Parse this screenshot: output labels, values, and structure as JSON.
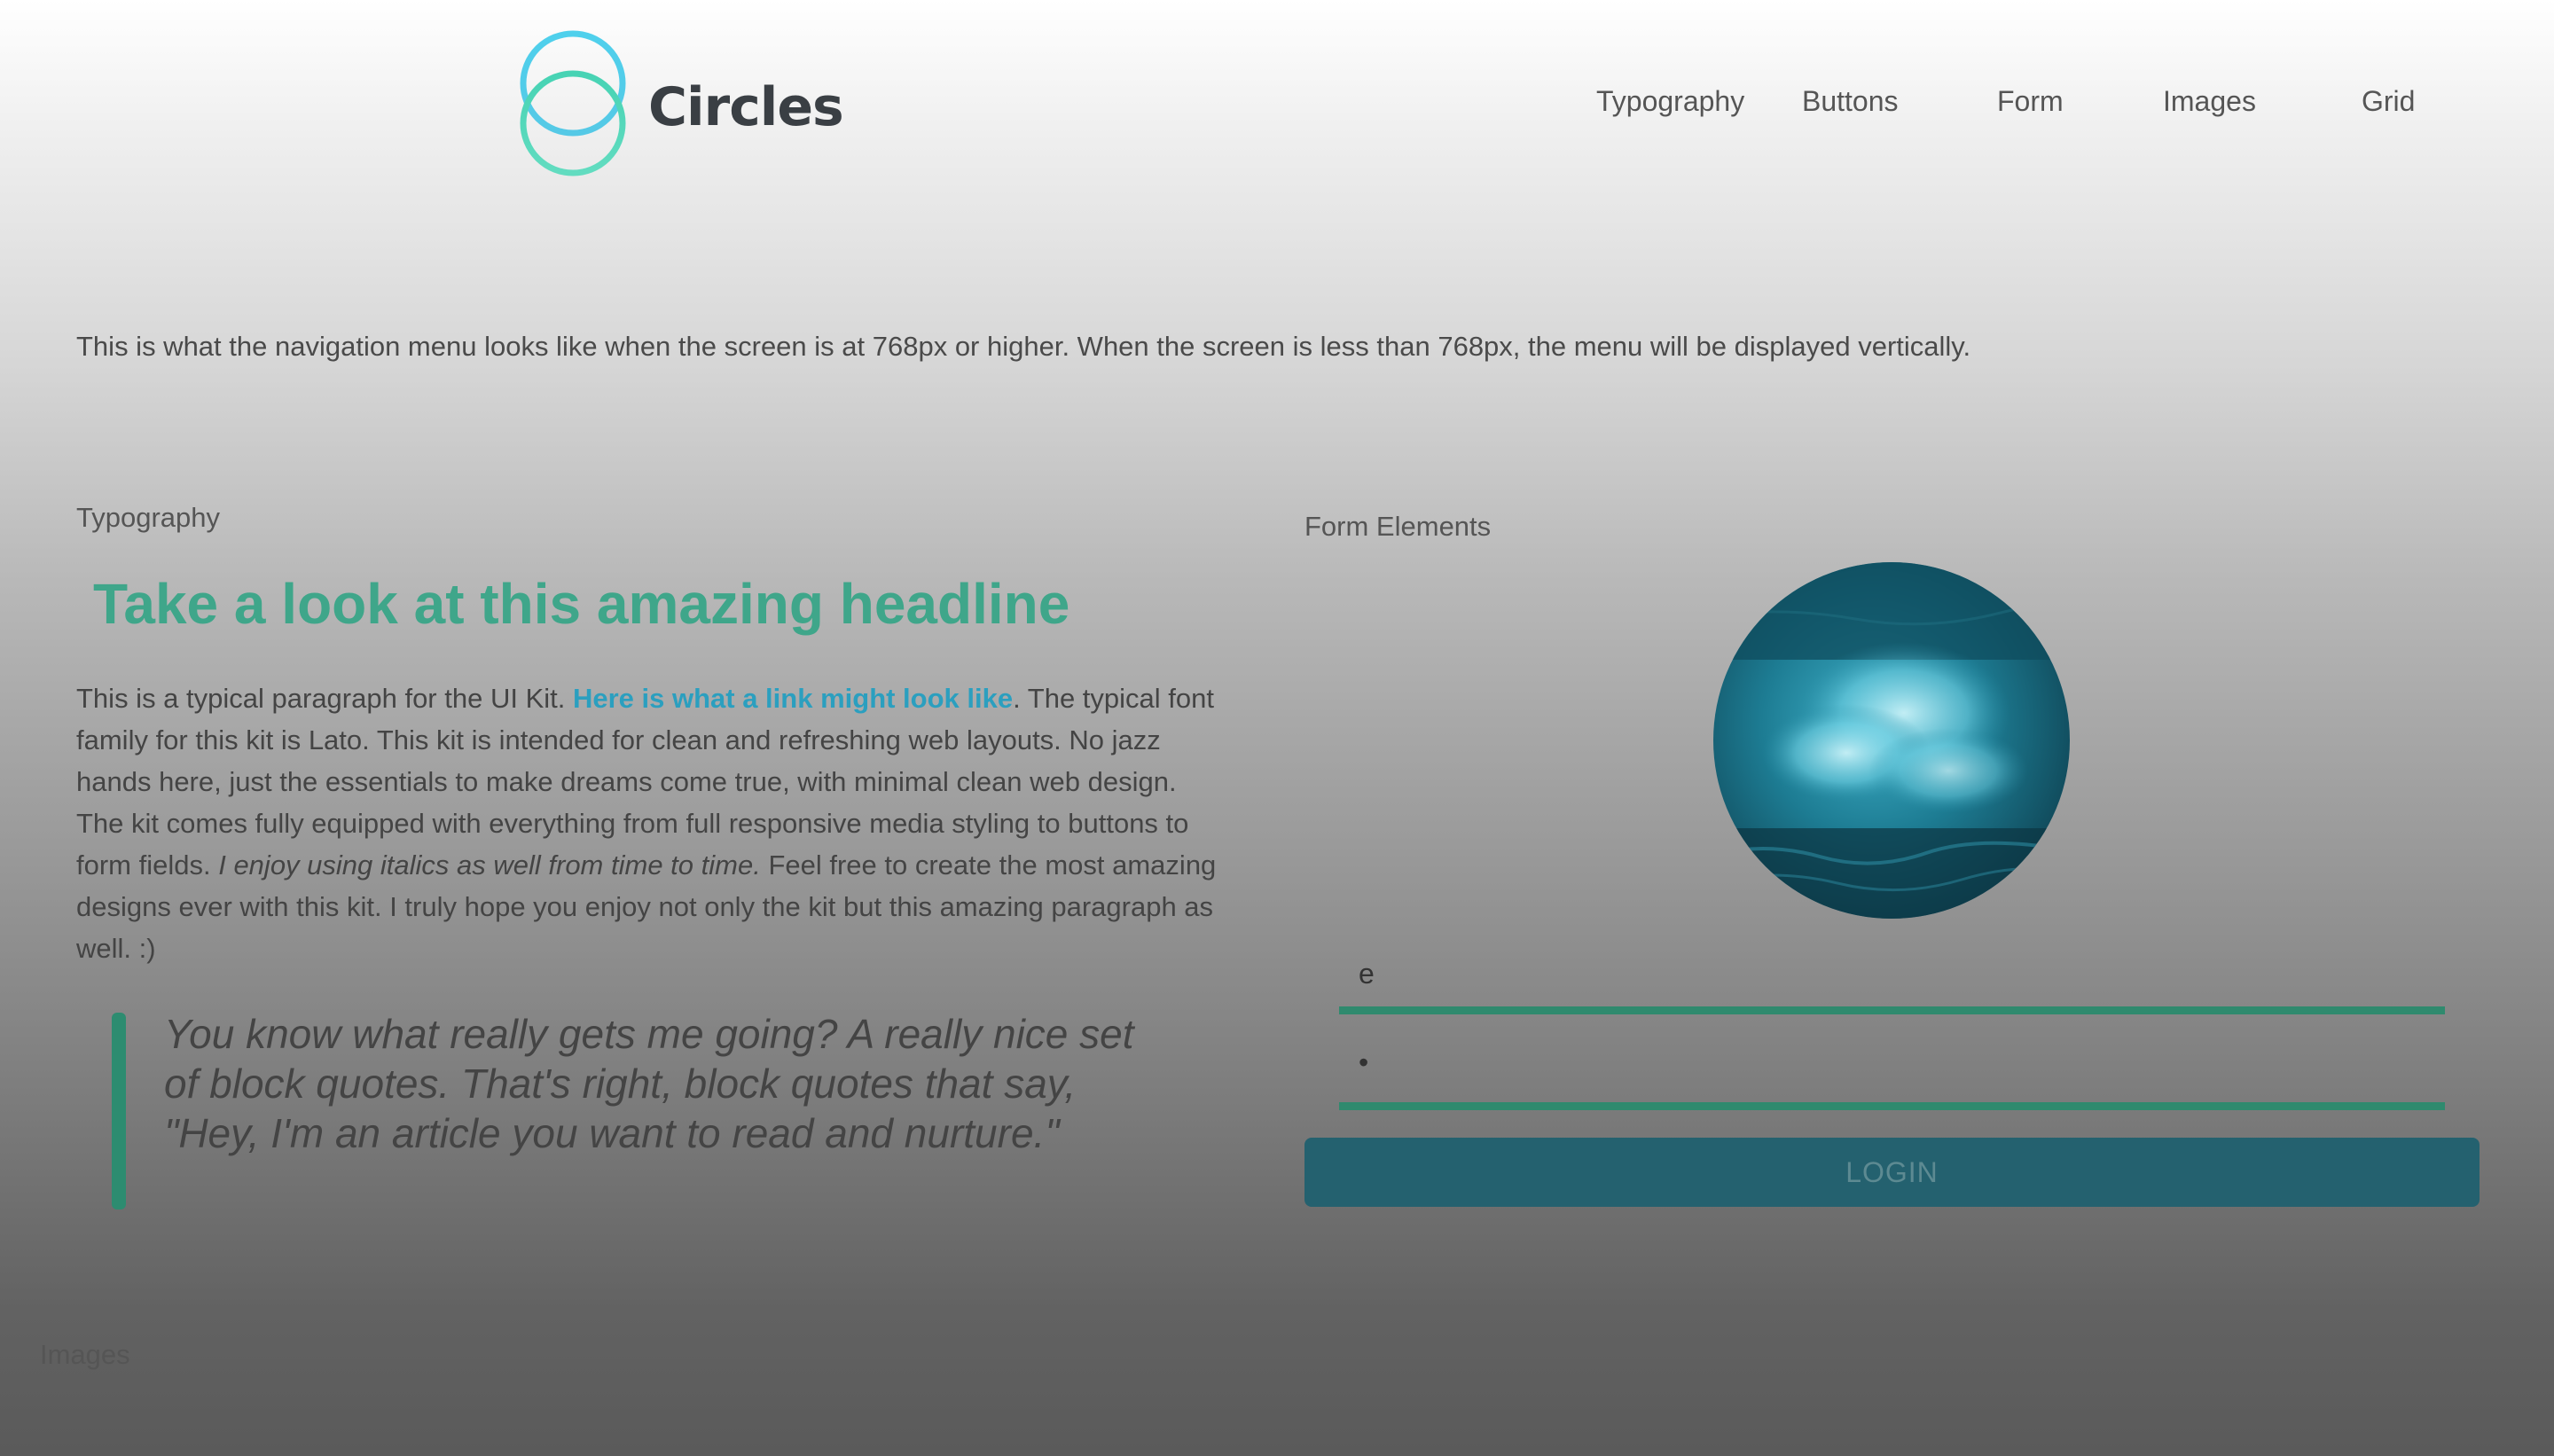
{
  "header": {
    "logo_text": "Circles",
    "nav": [
      {
        "label": "Typography"
      },
      {
        "label": "Buttons"
      },
      {
        "label": "Form"
      },
      {
        "label": "Images"
      },
      {
        "label": "Grid"
      }
    ],
    "note": "This is what the navigation menu looks like when the screen is at 768px or higher. When the screen is less than 768px, the menu will be displayed vertically."
  },
  "typography": {
    "label": "Typography",
    "headline": "Take a look at this amazing headline",
    "paragraph": {
      "part1": "This is a typical paragraph for the UI Kit. ",
      "link": "Here is what a link might look like",
      "part2": ". The typical font family for this kit is Lato. This kit is intended for clean and refreshing web layouts. No jazz hands here, just the essentials to make dreams come true, with minimal clean web design. The kit comes fully equipped with everything from full responsive media styling to buttons to form fields. ",
      "italic": "I enjoy using italics as well from time to time.",
      "part3": " Feel free to create the most amazing designs ever with this kit. I truly hope you enjoy not only the kit but this amazing paragraph as well. :)"
    },
    "blockquote": "You know what really gets me going? A really nice set of block quotes. That's right, block quotes that say, \"Hey, I'm an article you want to read and nurture.\""
  },
  "form": {
    "label": "Form Elements",
    "username_value": "e",
    "password_value": "•",
    "login_label": "LOGIN"
  },
  "images": {
    "label": "Images"
  },
  "colors": {
    "headline": "#3fa68a",
    "link": "#2b9fbf",
    "accent_green": "#2f8a6e",
    "login_button": "#24616f"
  }
}
